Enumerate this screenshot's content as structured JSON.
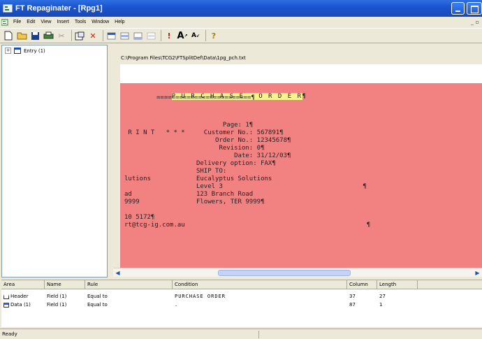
{
  "window": {
    "title": "FT Repaginater - [Rpg1]"
  },
  "menu": [
    "File",
    "Edit",
    "View",
    "Insert",
    "Tools",
    "Window",
    "Help"
  ],
  "toolbar": {
    "icons": [
      "new-icon",
      "open-icon",
      "save-icon",
      "print-icon",
      "cut-icon",
      "properties-icon",
      "delete-icon",
      "area-header-icon",
      "area-data-icon",
      "area-footer-icon",
      "area-other-icon",
      "exclamation-icon",
      "font-larger-icon",
      "font-smaller-icon",
      "help-icon"
    ]
  },
  "tree": {
    "root_label": "Entry (1)",
    "expander": "+"
  },
  "document": {
    "path": "C:\\Program Files\\TCG2\\FTSplitDef\\Data\\1pg_pch.txt",
    "title_text": "P U R C H A S E   O R D E R",
    "pilcrow": "¶",
    "underline": "=========================¶",
    "lines": [
      "                          Page: 1¶",
      " R I N T   * * *     Customer No.: 567891¶",
      "                        Order No.: 12345678¶",
      "                         Revision: 0¶",
      "                             Date: 31/12/03¶",
      "                   Delivery option: FAX¶",
      "                   SHIP TO:",
      "lutions            Eucalyptus Solutions",
      "                   Level 3                                     ¶",
      "ad                 123 Branch Road",
      "9999               Flowers, TER 9999¶",
      "",
      "10 5172¶",
      "rt@tcg-ig.com.au                                                ¶"
    ]
  },
  "list": {
    "headers": [
      "Area",
      "Name",
      "Rule",
      "Condition",
      "Column",
      "Length"
    ],
    "rows": [
      {
        "area": "Header",
        "name": "Field (1)",
        "rule": "Equal to",
        "condition": "PURCHASE ORDER",
        "column": "37",
        "length": "27"
      },
      {
        "area": "Data (1)",
        "name": "Field (1)",
        "rule": "Equal to",
        "condition": ".",
        "column": "87",
        "length": "1"
      }
    ]
  },
  "status": {
    "text": "Ready"
  },
  "colors": {
    "title_bar": "#1b55d0",
    "document_bg": "#f28282",
    "highlight": "#f5f58a"
  }
}
